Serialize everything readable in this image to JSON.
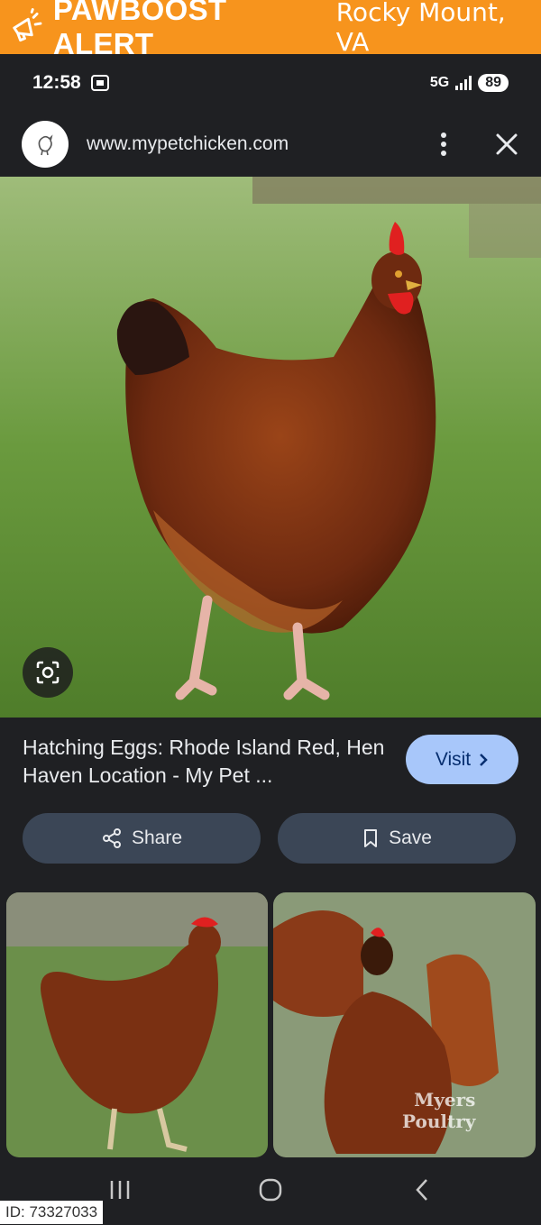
{
  "banner": {
    "brand": "PAWBOOST ALERT",
    "location": "Rocky Mount, VA",
    "icon": "megaphone-icon",
    "color": "#f7941d"
  },
  "status": {
    "time": "12:58",
    "network": "5G",
    "battery": "89"
  },
  "browser": {
    "url": "www.mypetchicken.com",
    "site_icon": "chicken-logo-icon"
  },
  "result": {
    "title": "Hatching Eggs: Rhode Island Red, Hen Haven Location - My Pet ...",
    "visit_label": "Visit",
    "share_label": "Share",
    "save_label": "Save"
  },
  "thumbnails": [
    {
      "watermark": ""
    },
    {
      "watermark_line1": "Myers",
      "watermark_line2": "Poultry"
    }
  ],
  "footer": {
    "id": "ID: 73327033"
  },
  "colors": {
    "background": "#1f2023",
    "button": "#3b4656",
    "visit_button": "#a8c7fa"
  }
}
